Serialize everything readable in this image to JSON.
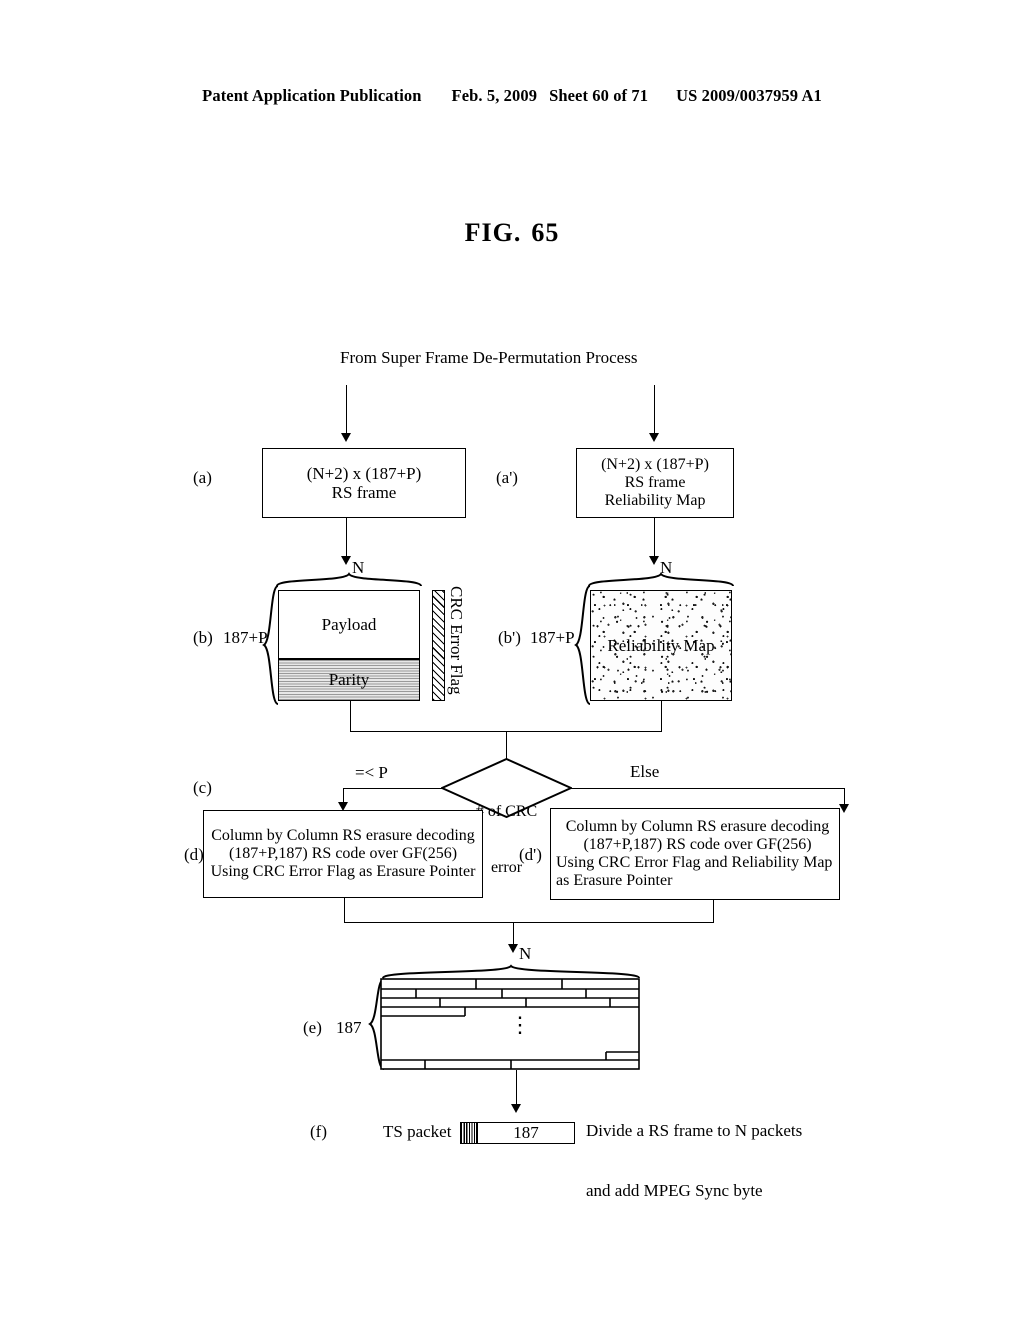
{
  "header": {
    "publication": "Patent Application Publication",
    "date": "Feb. 5, 2009",
    "sheet": "Sheet 60 of 71",
    "patent_number": "US 2009/0037959 A1"
  },
  "figure": {
    "label": "FIG.",
    "number": "65"
  },
  "diagram": {
    "source_caption": "From Super Frame De-Permutation Process",
    "steps": {
      "a": {
        "tag": "(a)",
        "box_line1": "(N+2) x (187+P)",
        "box_line2": "RS frame"
      },
      "a_prime": {
        "tag": "(a')",
        "box_line1": "(N+2) x (187+P)",
        "box_line2": "RS frame",
        "box_line3": "Reliability Map"
      },
      "b": {
        "tag": "(b)",
        "row_label": "187+P",
        "top_label": "N",
        "payload_label": "Payload",
        "parity_label": "Parity",
        "crc_flag_label": "CRC Error Flag"
      },
      "b_prime": {
        "tag": "(b')",
        "row_label": "187+P",
        "top_label": "N",
        "map_label": "Reliability Map"
      },
      "c": {
        "tag": "(c)",
        "decision_line1": "# of CRC",
        "decision_line2": "error",
        "branch_left": "=< P",
        "branch_right": "Else"
      },
      "d": {
        "tag": "(d)",
        "line1": "Column by Column RS erasure decoding",
        "line2": "(187+P,187) RS code over GF(256)",
        "line3": "Using CRC Error Flag as Erasure Pointer"
      },
      "d_prime": {
        "tag": "(d')",
        "line1": "Column by Column RS erasure decoding",
        "line2": "(187+P,187) RS code over GF(256)",
        "line3": "Using CRC Error Flag and Reliability Map",
        "line4": "as Erasure Pointer"
      },
      "e": {
        "tag": "(e)",
        "row_label": "187",
        "top_label": "N",
        "ellipsis": "⋮"
      },
      "f": {
        "tag": "(f)",
        "packet_label": "TS packet",
        "packet_size": "187",
        "note_line1": "Divide a RS frame to N packets",
        "note_line2": "and add MPEG Sync byte"
      }
    }
  }
}
